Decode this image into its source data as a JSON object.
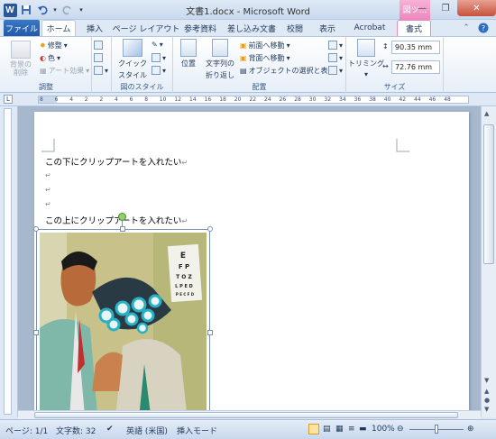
{
  "title_bar": {
    "window_title": "文書1.docx - Microsoft Word",
    "context_tab_label": "図ツ..."
  },
  "tabs": [
    "ファイル",
    "ホーム",
    "挿入",
    "ページ レイアウト",
    "参考資料",
    "差し込み文書",
    "校閲",
    "表示",
    "Acrobat",
    "書式"
  ],
  "ribbon": {
    "adjust": {
      "remove_bg": "背景の削除",
      "corrections": "修整",
      "color": "色",
      "artistic": "アート効果",
      "label": "調整"
    },
    "styles": {
      "quick_style": "クイック",
      "quick_style2": "スタイル",
      "label": "図のスタイル"
    },
    "arrange": {
      "position": "位置",
      "wrap": "文字列の",
      "wrap2": "折り返し",
      "bring_forward": "前面へ移動",
      "send_backward": "背面へ移動",
      "selection_pane": "オブジェクトの選択と表示",
      "label": "配置"
    },
    "size": {
      "crop": "トリミング",
      "height": "90.35 mm",
      "width": "72.76 mm",
      "label": "サイズ"
    }
  },
  "ruler_numbers": [
    "8",
    "6",
    "4",
    "2",
    "2",
    "4",
    "6",
    "8",
    "10",
    "12",
    "14",
    "16",
    "18",
    "20",
    "22",
    "24",
    "26",
    "28",
    "30",
    "32",
    "34",
    "36",
    "38",
    "40",
    "42",
    "44",
    "46",
    "48"
  ],
  "document": {
    "line1": "この下にクリップアートを入れたい",
    "line4": "この上にクリップアートを入れたい",
    "para_mark": "↵",
    "chart_text": [
      "E",
      "F P",
      "T O Z",
      "L P E D",
      "P E C F D"
    ]
  },
  "status": {
    "page": "ページ: 1/1",
    "words": "文字数: 32",
    "language": "英語 (米国)",
    "mode": "挿入モード",
    "zoom": "100%"
  },
  "colors": {
    "file_tab": "#2359a9",
    "context_tab": "#ec87bd"
  }
}
